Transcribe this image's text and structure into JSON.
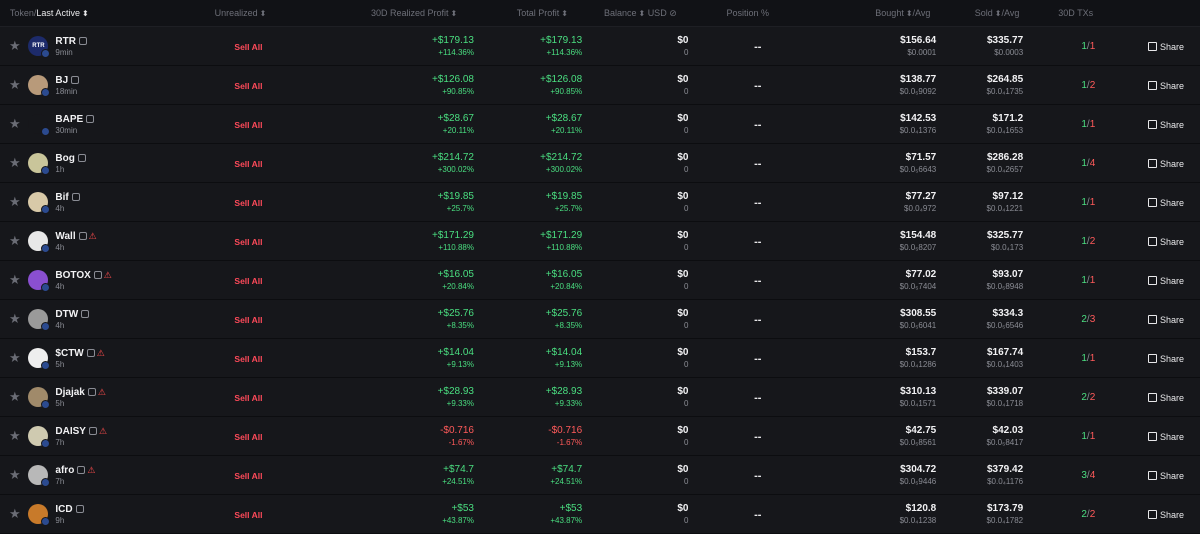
{
  "header": {
    "token_label": "Token",
    "last_active_label": "Last Active",
    "unrealized": "Unrealized",
    "realized": "30D Realized Profit",
    "total": "Total Profit",
    "balance": "Balance",
    "balance_unit": "USD",
    "position": "Position %",
    "bought": "Bought",
    "bought_avg": "/Avg",
    "sold": "Sold",
    "sold_avg": "/Avg",
    "txs": "30D TXs"
  },
  "sell_label": "Sell All",
  "share_label": "Share",
  "position_value": "--",
  "rows": [
    {
      "name": "RTR",
      "age": "9min",
      "warn": "",
      "avatar": "#1d2b6b",
      "avatar_text": "RTR",
      "rp": "+$179.13",
      "rp_pct": "+114.36%",
      "tp": "+$179.13",
      "tp_pct": "+114.36%",
      "bal": "$0",
      "bal_sub": "0",
      "bought": "$156.64",
      "bought_avg": "$0.0001",
      "sold": "$335.77",
      "sold_avg": "$0.0003",
      "tx_buy": "1",
      "tx_sell": "1",
      "neg": false
    },
    {
      "name": "BJ",
      "age": "18min",
      "warn": "",
      "avatar": "#b89a7a",
      "avatar_text": "",
      "rp": "+$126.08",
      "rp_pct": "+90.85%",
      "tp": "+$126.08",
      "tp_pct": "+90.85%",
      "bal": "$0",
      "bal_sub": "0",
      "bought": "$138.77",
      "bought_avg": "$0.0₅9092",
      "sold": "$264.85",
      "sold_avg": "$0.0₄1735",
      "tx_buy": "1",
      "tx_sell": "2",
      "neg": false
    },
    {
      "name": "BAPE",
      "age": "30min",
      "warn": "",
      "avatar": "#16171b",
      "avatar_text": "",
      "rp": "+$28.67",
      "rp_pct": "+20.11%",
      "tp": "+$28.67",
      "tp_pct": "+20.11%",
      "bal": "$0",
      "bal_sub": "0",
      "bought": "$142.53",
      "bought_avg": "$0.0₄1376",
      "sold": "$171.2",
      "sold_avg": "$0.0₄1653",
      "tx_buy": "1",
      "tx_sell": "1",
      "neg": false
    },
    {
      "name": "Bog",
      "age": "1h",
      "warn": "",
      "avatar": "#c9c59a",
      "avatar_text": "",
      "rp": "+$214.72",
      "rp_pct": "+300.02%",
      "tp": "+$214.72",
      "tp_pct": "+300.02%",
      "bal": "$0",
      "bal_sub": "0",
      "bought": "$71.57",
      "bought_avg": "$0.0₅6643",
      "sold": "$286.28",
      "sold_avg": "$0.0₄2657",
      "tx_buy": "1",
      "tx_sell": "4",
      "neg": false
    },
    {
      "name": "Bif",
      "age": "4h",
      "warn": "",
      "avatar": "#d8c9a8",
      "avatar_text": "",
      "rp": "+$19.85",
      "rp_pct": "+25.7%",
      "tp": "+$19.85",
      "tp_pct": "+25.7%",
      "bal": "$0",
      "bal_sub": "0",
      "bought": "$77.27",
      "bought_avg": "$0.0₄972",
      "sold": "$97.12",
      "sold_avg": "$0.0₄1221",
      "tx_buy": "1",
      "tx_sell": "1",
      "neg": false
    },
    {
      "name": "Wall",
      "age": "4h",
      "warn": "⚠",
      "avatar": "#e8e8e8",
      "avatar_text": "",
      "rp": "+$171.29",
      "rp_pct": "+110.88%",
      "tp": "+$171.29",
      "tp_pct": "+110.88%",
      "bal": "$0",
      "bal_sub": "0",
      "bought": "$154.48",
      "bought_avg": "$0.0₅8207",
      "sold": "$325.77",
      "sold_avg": "$0.0₄173",
      "tx_buy": "1",
      "tx_sell": "2",
      "neg": false
    },
    {
      "name": "BOTOX",
      "age": "4h",
      "warn": "⚠",
      "avatar": "#8a4fd0",
      "avatar_text": "",
      "rp": "+$16.05",
      "rp_pct": "+20.84%",
      "tp": "+$16.05",
      "tp_pct": "+20.84%",
      "bal": "$0",
      "bal_sub": "0",
      "bought": "$77.02",
      "bought_avg": "$0.0₅7404",
      "sold": "$93.07",
      "sold_avg": "$0.0₅8948",
      "tx_buy": "1",
      "tx_sell": "1",
      "neg": false
    },
    {
      "name": "DTW",
      "age": "4h",
      "warn": "",
      "avatar": "#9a9a9a",
      "avatar_text": "",
      "rp": "+$25.76",
      "rp_pct": "+8.35%",
      "tp": "+$25.76",
      "tp_pct": "+8.35%",
      "bal": "$0",
      "bal_sub": "0",
      "bought": "$308.55",
      "bought_avg": "$0.0₅6041",
      "sold": "$334.3",
      "sold_avg": "$0.0₅6546",
      "tx_buy": "2",
      "tx_sell": "3",
      "neg": false
    },
    {
      "name": "$CTW",
      "age": "5h",
      "warn": "⚠",
      "avatar": "#eeeeee",
      "avatar_text": "",
      "rp": "+$14.04",
      "rp_pct": "+9.13%",
      "tp": "+$14.04",
      "tp_pct": "+9.13%",
      "bal": "$0",
      "bal_sub": "0",
      "bought": "$153.7",
      "bought_avg": "$0.0₄1286",
      "sold": "$167.74",
      "sold_avg": "$0.0₄1403",
      "tx_buy": "1",
      "tx_sell": "1",
      "neg": false
    },
    {
      "name": "Djajak",
      "age": "5h",
      "warn": "⚠",
      "avatar": "#a08a6a",
      "avatar_text": "",
      "rp": "+$28.93",
      "rp_pct": "+9.33%",
      "tp": "+$28.93",
      "tp_pct": "+9.33%",
      "bal": "$0",
      "bal_sub": "0",
      "bought": "$310.13",
      "bought_avg": "$0.0₄1571",
      "sold": "$339.07",
      "sold_avg": "$0.0₄1718",
      "tx_buy": "2",
      "tx_sell": "2",
      "neg": false
    },
    {
      "name": "DAISY",
      "age": "7h",
      "warn": "⚠",
      "avatar": "#cfcab0",
      "avatar_text": "",
      "rp": "-$0.716",
      "rp_pct": "-1.67%",
      "tp": "-$0.716",
      "tp_pct": "-1.67%",
      "bal": "$0",
      "bal_sub": "0",
      "bought": "$42.75",
      "bought_avg": "$0.0₅8561",
      "sold": "$42.03",
      "sold_avg": "$0.0₅8417",
      "tx_buy": "1",
      "tx_sell": "1",
      "neg": true
    },
    {
      "name": "afro",
      "age": "7h",
      "warn": "⚠",
      "avatar": "#b8b8b8",
      "avatar_text": "",
      "rp": "+$74.7",
      "rp_pct": "+24.51%",
      "tp": "+$74.7",
      "tp_pct": "+24.51%",
      "bal": "$0",
      "bal_sub": "0",
      "bought": "$304.72",
      "bought_avg": "$0.0₅9446",
      "sold": "$379.42",
      "sold_avg": "$0.0₄1176",
      "tx_buy": "3",
      "tx_sell": "4",
      "neg": false
    },
    {
      "name": "ICD",
      "age": "9h",
      "warn": "",
      "avatar": "#c87a2a",
      "avatar_text": "",
      "rp": "+$53",
      "rp_pct": "+43.87%",
      "tp": "+$53",
      "tp_pct": "+43.87%",
      "bal": "$0",
      "bal_sub": "0",
      "bought": "$120.8",
      "bought_avg": "$0.0₄1238",
      "sold": "$173.79",
      "sold_avg": "$0.0₄1782",
      "tx_buy": "2",
      "tx_sell": "2",
      "neg": false
    }
  ]
}
